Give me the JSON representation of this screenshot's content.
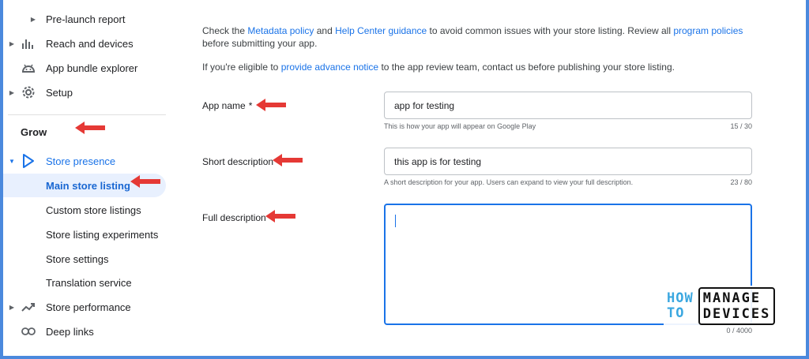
{
  "sidebar": {
    "items": [
      {
        "label": "Pre-launch report",
        "icon": "caret-right-icon"
      },
      {
        "label": "Reach and devices",
        "icon": "bar-chart-icon"
      },
      {
        "label": "App bundle explorer",
        "icon": "android-icon"
      },
      {
        "label": "Setup",
        "icon": "gear-icon"
      }
    ],
    "section_title": "Grow",
    "grow_items": [
      {
        "label": "Store presence",
        "icon": "play-triangle-icon"
      },
      {
        "label": "Main store listing"
      },
      {
        "label": "Custom store listings"
      },
      {
        "label": "Store listing experiments"
      },
      {
        "label": "Store settings"
      },
      {
        "label": "Translation service"
      },
      {
        "label": "Store performance",
        "icon": "trending-up-icon"
      },
      {
        "label": "Deep links",
        "icon": "link-icon"
      }
    ]
  },
  "main": {
    "intro": {
      "t1": "Check the ",
      "link1": "Metadata policy",
      "t2": " and ",
      "link2": "Help Center guidance",
      "t3": " to avoid common issues with your store listing. Review all ",
      "link3": "program policies",
      "t4": " before submitting your app."
    },
    "notice": {
      "t1": "If you're eligible to ",
      "link1": "provide advance notice",
      "t2": " to the app review team, contact us before publishing your store listing."
    },
    "fields": {
      "app_name": {
        "label": "App name",
        "required_mark": "*",
        "value": "app for testing",
        "helper": "This is how your app will appear on Google Play",
        "counter": "15 / 30"
      },
      "short_description": {
        "label": "Short description",
        "value": "this app is for testing",
        "helper": "A short description for your app. Users can expand to view your full description.",
        "counter": "23 / 80"
      },
      "full_description": {
        "label": "Full description",
        "value": "",
        "counter": "0 / 4000"
      }
    }
  },
  "watermark": {
    "how": "HOW",
    "to": "TO",
    "manage": "MANAGE",
    "devices": "DEVICES"
  },
  "colors": {
    "accent": "#1a73e8",
    "arrow": "#e53935",
    "border_frame": "#4b89dd"
  }
}
